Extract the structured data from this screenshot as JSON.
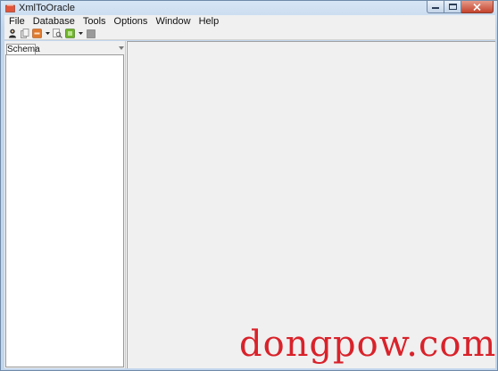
{
  "window": {
    "title": "XmlToOracle"
  },
  "menubar": {
    "items": [
      "File",
      "Database",
      "Tools",
      "Options",
      "Window",
      "Help"
    ]
  },
  "toolbar": {
    "buttons": [
      {
        "icon": "user-connect-icon"
      },
      {
        "icon": "copy-document-icon"
      },
      {
        "icon": "xml-icon"
      },
      {
        "icon": "dropdown-arrow-icon"
      },
      {
        "icon": "search-document-icon"
      },
      {
        "icon": "green-tag-icon"
      },
      {
        "icon": "dropdown-arrow-icon"
      },
      {
        "icon": "stop-icon"
      }
    ]
  },
  "left_panel": {
    "tab_label": "Schema"
  },
  "watermark": {
    "text": "dongpow.com"
  },
  "colors": {
    "accent": "#d9222a",
    "titlebar": "#c2d6ec",
    "close_button": "#c4432c",
    "xml_icon": "#e07a2e",
    "tag_icon": "#6fb52a"
  }
}
